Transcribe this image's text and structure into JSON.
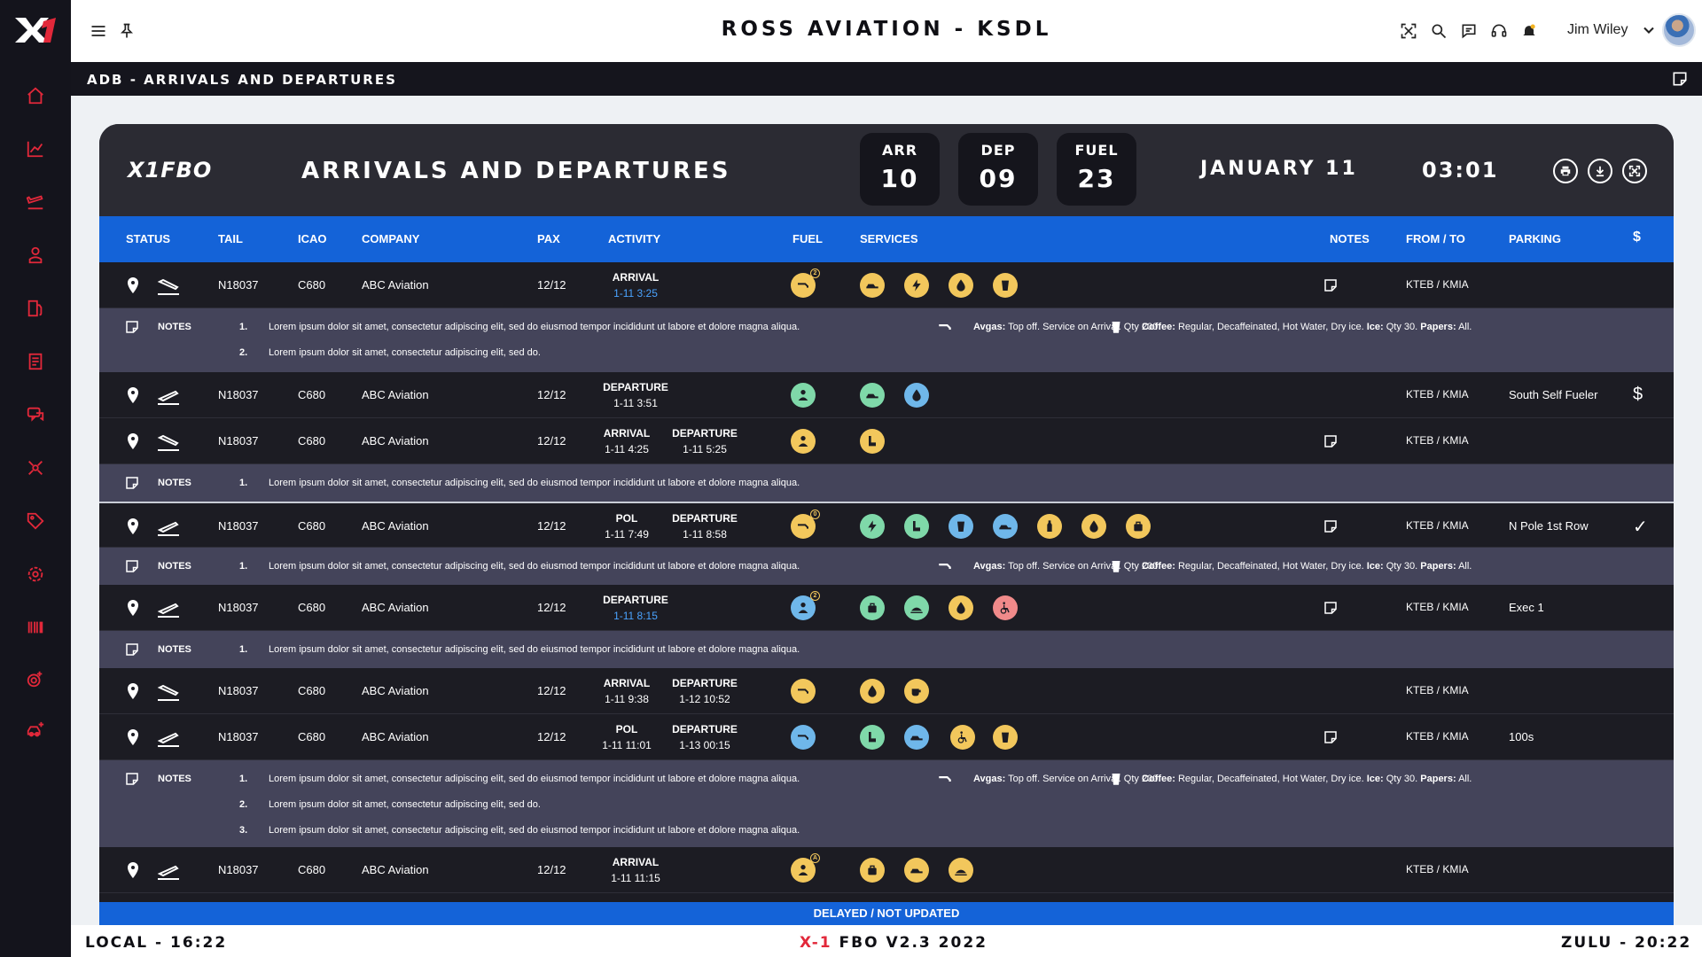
{
  "app_title": "ROSS AVIATION - KSDL",
  "user": {
    "name": "Jim Wiley"
  },
  "subheader": {
    "title": "ADB - ARRIVALS AND DEPARTURES"
  },
  "card": {
    "brand": "X1FBO",
    "title": "ARRIVALS AND DEPARTURES",
    "counters": [
      {
        "label": "ARR",
        "value": "10"
      },
      {
        "label": "DEP",
        "value": "09"
      },
      {
        "label": "FUEL",
        "value": "23"
      }
    ],
    "date": "JANUARY  11",
    "time": "03:01"
  },
  "columns": {
    "status": "STATUS",
    "tail": "TAIL",
    "icao": "ICAO",
    "company": "COMPANY",
    "pax": "PAX",
    "activity": "ACTIVITY",
    "fuel": "FUEL",
    "services": "SERVICES",
    "notes": "NOTES",
    "from_to": "FROM / TO",
    "parking": "PARKING",
    "dollar": "$"
  },
  "notes_label": "NOTES",
  "lorem_long": "Lorem ipsum dolor sit amet, consectetur adipiscing elit, sed do eiusmod tempor incididunt ut labore et dolore magna aliqua.",
  "lorem_short": "Lorem ipsum dolor sit amet, consectetur adipiscing elit, sed do.",
  "fuel_note": {
    "label": "Avgas:",
    "text": " Top off. Service on Arrival. Qty 200"
  },
  "cafe_note": {
    "label1": "Coffee:",
    "text1": " Regular, Decaffeinated, Hot Water, Dry ice. ",
    "label2": "Ice:",
    "text2": " Qty 30. ",
    "label3": "Papers:",
    "text3": " All."
  },
  "rows": [
    {
      "tail": "N18037",
      "icao": "C680",
      "company": "ABC Aviation",
      "pax": "12/12",
      "a1": "ARRIVAL",
      "d1": "1-11  3:25",
      "a2": "",
      "d2": "",
      "route": "KTEB / KMIA",
      "parking": "",
      "end": ""
    },
    {
      "tail": "N18037",
      "icao": "C680",
      "company": "ABC Aviation",
      "pax": "12/12",
      "a1": "DEPARTURE",
      "d1": "1-11  3:51",
      "a2": "",
      "d2": "",
      "route": "KTEB / KMIA",
      "parking": "South Self Fueler",
      "end": "$"
    },
    {
      "tail": "N18037",
      "icao": "C680",
      "company": "ABC Aviation",
      "pax": "12/12",
      "a1": "ARRIVAL",
      "d1": "1-11  4:25",
      "a2": "DEPARTURE",
      "d2": "1-11  5:25",
      "route": "KTEB / KMIA",
      "parking": "",
      "end": ""
    },
    {
      "tail": "N18037",
      "icao": "C680",
      "company": "ABC Aviation",
      "pax": "12/12",
      "a1": "POL",
      "d1": "1-11 7:49",
      "a2": "DEPARTURE",
      "d2": "1-11  8:58",
      "route": "KTEB / KMIA",
      "parking": "N Pole 1st Row",
      "end": "✓"
    },
    {
      "tail": "N18037",
      "icao": "C680",
      "company": "ABC Aviation",
      "pax": "12/12",
      "a1": "DEPARTURE",
      "d1": "1-11  8:15",
      "a2": "",
      "d2": "",
      "route": "KTEB / KMIA",
      "parking": "Exec 1",
      "end": ""
    },
    {
      "tail": "N18037",
      "icao": "C680",
      "company": "ABC Aviation",
      "pax": "12/12",
      "a1": "ARRIVAL",
      "d1": "1-11  9:38",
      "a2": "DEPARTURE",
      "d2": "1-12  10:52",
      "route": "KTEB / KMIA",
      "parking": "",
      "end": ""
    },
    {
      "tail": "N18037",
      "icao": "C680",
      "company": "ABC Aviation",
      "pax": "12/12",
      "a1": "POL",
      "d1": "1-11  11:01",
      "a2": "DEPARTURE",
      "d2": "1-13  00:15",
      "route": "KTEB / KMIA",
      "parking": "100s",
      "end": ""
    },
    {
      "tail": "N18037",
      "icao": "C680",
      "company": "ABC Aviation",
      "pax": "12/12",
      "a1": "ARRIVAL",
      "d1": "1-11  11:15",
      "a2": "",
      "d2": "",
      "route": "KTEB / KMIA",
      "parking": "",
      "end": ""
    }
  ],
  "fuel_badges": {
    "r0": "2",
    "r3": "0",
    "r4": "2",
    "r7": "A"
  },
  "note_numbers": [
    "1.",
    "2.",
    "3."
  ],
  "status_bar": "DELAYED / NOT UPDATED",
  "footer": {
    "local": "LOCAL - 16:22",
    "version_x": "X-1",
    "version_rest": " FBO V2.3 2022",
    "zulu": "ZULU - 20:22"
  },
  "colors": {
    "accent_red": "#e2283a",
    "header_blue": "#1463d8",
    "svc_yellow": "#f2c75c",
    "svc_green": "#7fd8a9",
    "svc_blue": "#6fb7ea",
    "svc_pink": "#f08a8a"
  }
}
